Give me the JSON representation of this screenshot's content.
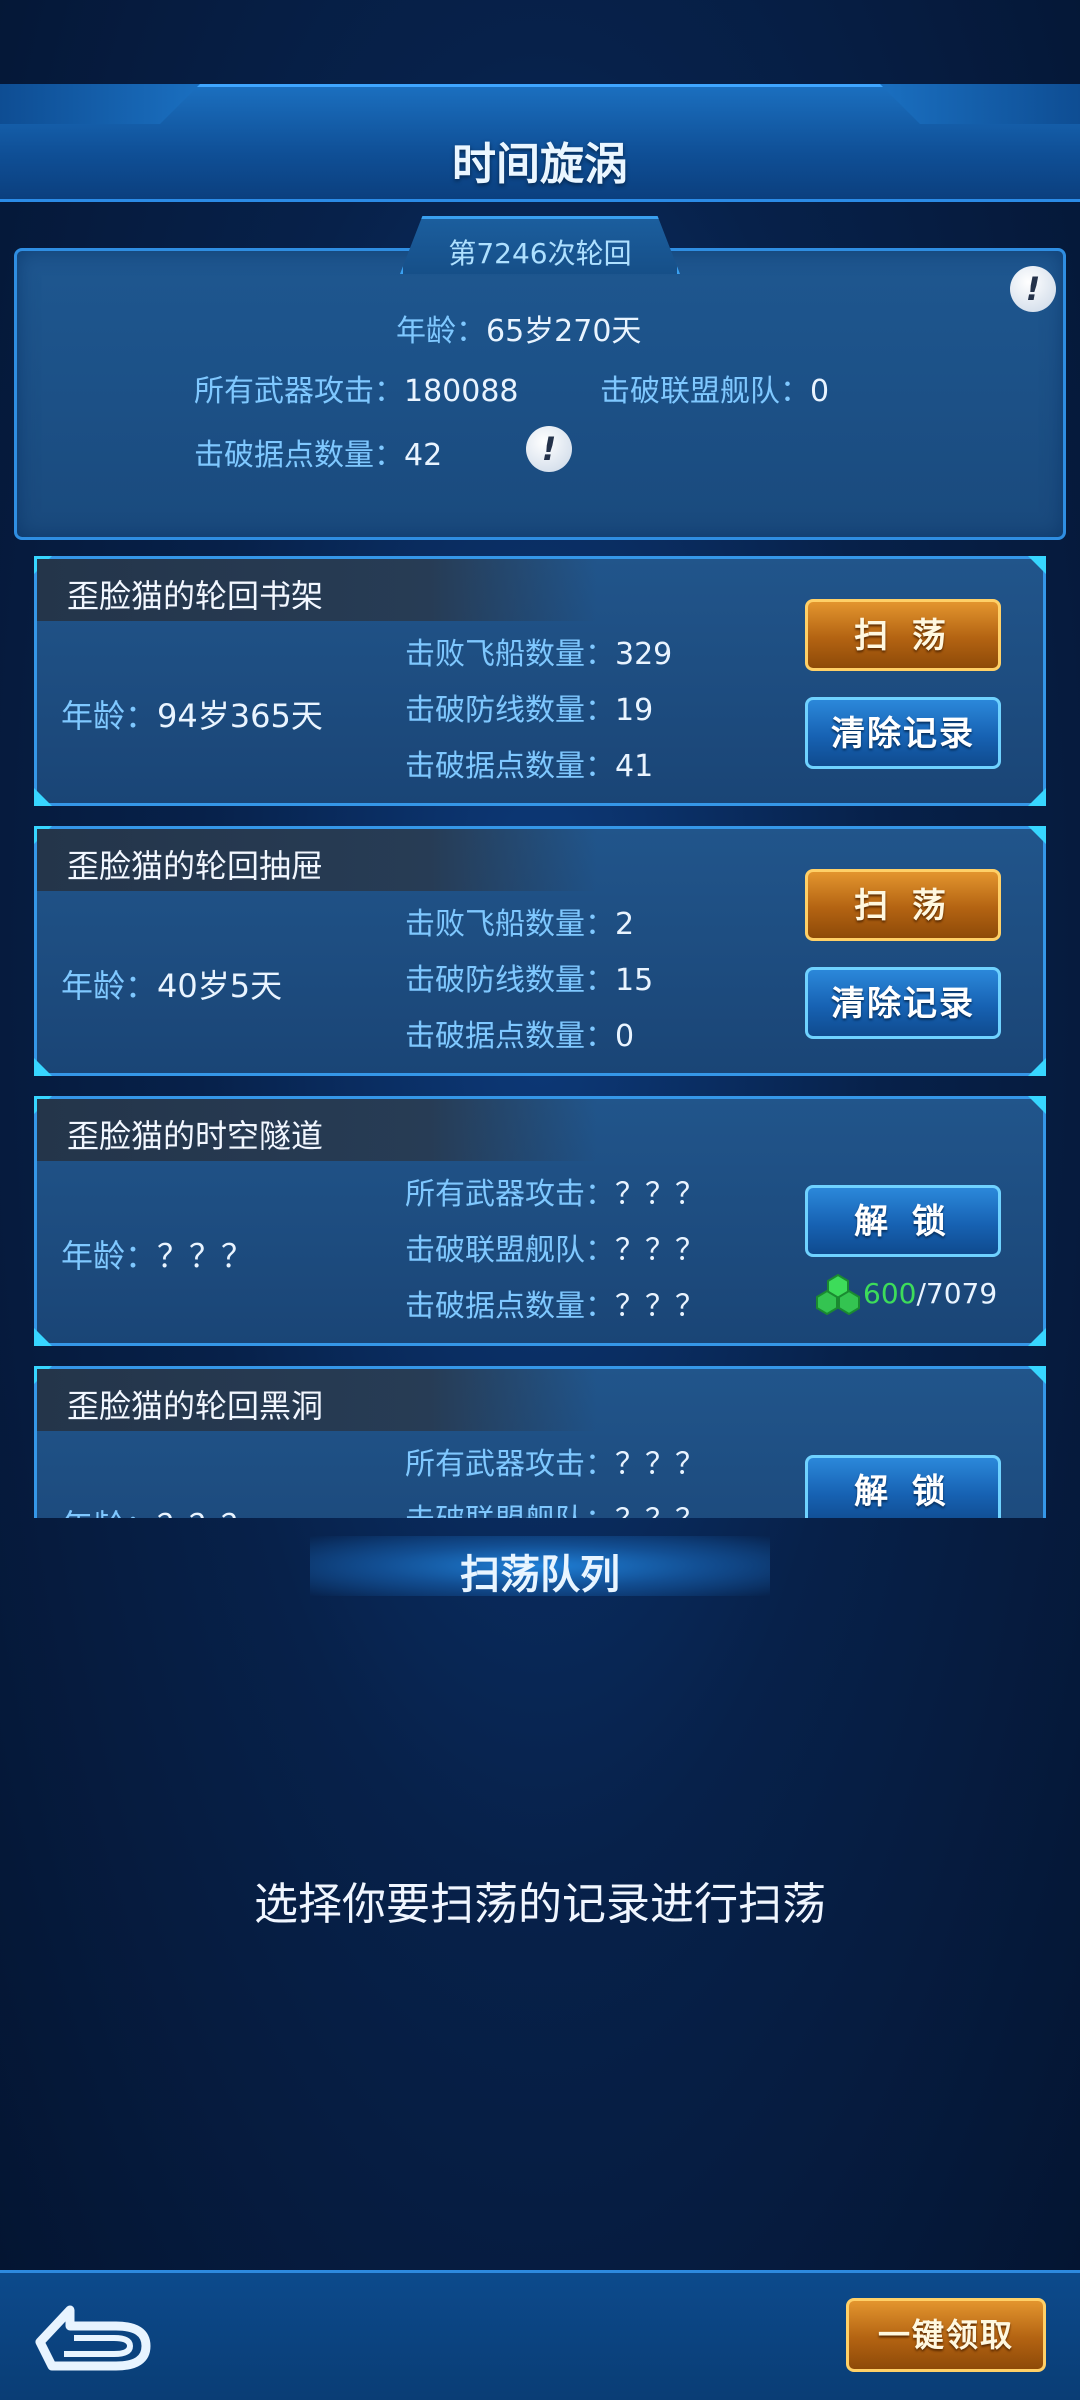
{
  "header": {
    "title": "时间旋涡"
  },
  "summary": {
    "cycle_label": "第7246次轮回",
    "age_label": "年龄：",
    "age_value": "65岁270天",
    "weapon_label": "所有武器攻击：",
    "weapon_value": "180088",
    "fleet_label": "击破联盟舰队：",
    "fleet_value": "0",
    "base_label": "击破据点数量：",
    "base_value": "42",
    "info_glyph": "!"
  },
  "records": [
    {
      "title": "歪脸猫的轮回书架",
      "age_label": "年龄：",
      "age_value": "94岁365天",
      "stats": [
        {
          "label": "击败飞船数量：",
          "value": "329"
        },
        {
          "label": "击破防线数量：",
          "value": "19"
        },
        {
          "label": "击破据点数量：",
          "value": "41"
        }
      ],
      "primary_button": "扫 荡",
      "secondary_button": "清除记录"
    },
    {
      "title": "歪脸猫的轮回抽屉",
      "age_label": "年龄：",
      "age_value": "40岁5天",
      "stats": [
        {
          "label": "击败飞船数量：",
          "value": "2"
        },
        {
          "label": "击破防线数量：",
          "value": "15"
        },
        {
          "label": "击破据点数量：",
          "value": "0"
        }
      ],
      "primary_button": "扫 荡",
      "secondary_button": "清除记录"
    },
    {
      "title": "歪脸猫的时空隧道",
      "age_label": "年龄：",
      "age_value": "？？？",
      "stats": [
        {
          "label": "所有武器攻击：",
          "value": "？？？"
        },
        {
          "label": "击破联盟舰队：",
          "value": "？？？"
        },
        {
          "label": "击破据点数量：",
          "value": "？？？"
        }
      ],
      "unlock_button": "解 锁",
      "cost_current": "600",
      "cost_total": "/7079"
    },
    {
      "title": "歪脸猫的轮回黑洞",
      "age_label": "年龄：",
      "age_value": "？？？",
      "stats": [
        {
          "label": "所有武器攻击：",
          "value": "？？？"
        },
        {
          "label": "击破联盟舰队：",
          "value": "？？？"
        }
      ],
      "unlock_button": "解 锁"
    }
  ],
  "queue": {
    "title": "扫荡队列",
    "hint": "选择你要扫荡的记录进行扫荡"
  },
  "bottom": {
    "claim_all": "一键领取"
  },
  "colors": {
    "accent_blue": "#3597e8",
    "label_blue": "#7fc8ff",
    "gem_green": "#3ddc5a",
    "button_orange": "#b36312"
  }
}
